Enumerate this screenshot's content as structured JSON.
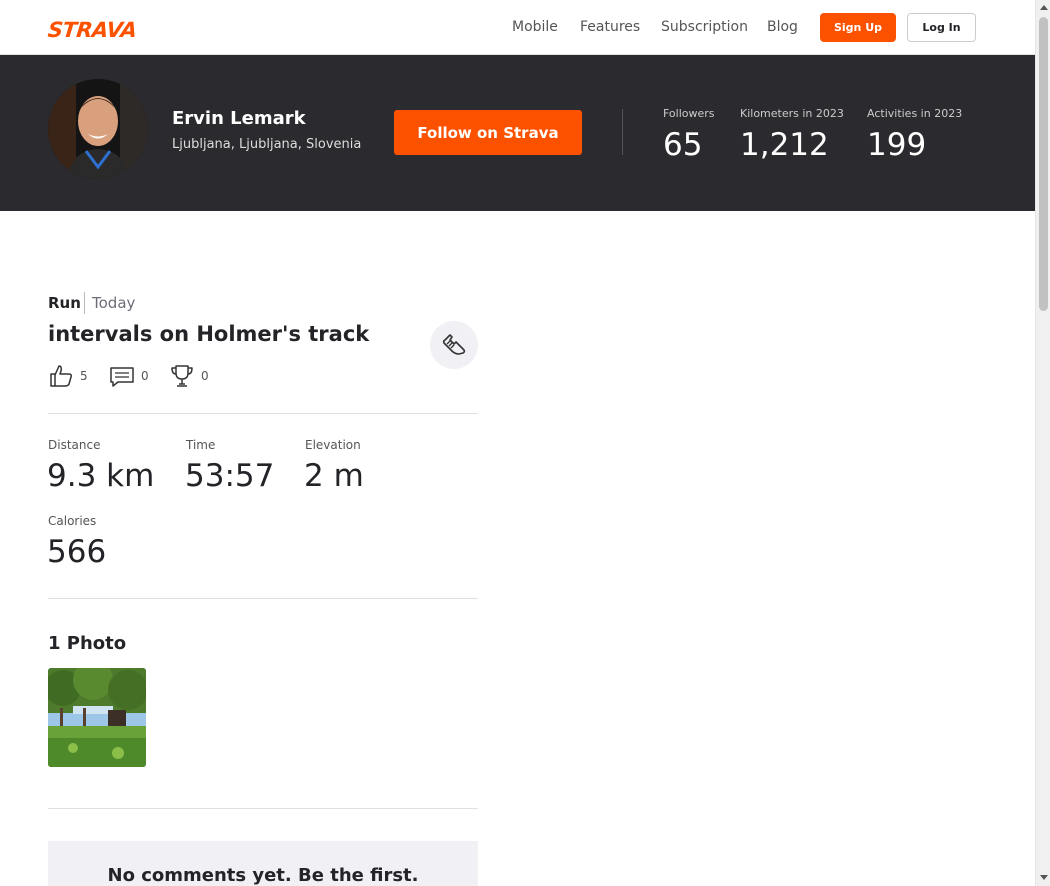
{
  "nav": {
    "logo": "STRAVA",
    "links": [
      "Mobile",
      "Features",
      "Subscription",
      "Blog"
    ],
    "signup_label": "Sign Up",
    "login_label": "Log In"
  },
  "athlete": {
    "name": "Ervin Lemark",
    "location": "Ljubljana, Ljubljana, Slovenia",
    "follow_label": "Follow on Strava",
    "stats": [
      {
        "label": "Followers",
        "value": "65"
      },
      {
        "label": "Kilometers in 2023",
        "value": "1,212"
      },
      {
        "label": "Activities in 2023",
        "value": "199"
      }
    ]
  },
  "activity": {
    "type": "Run",
    "date": "Today",
    "title": "intervals on Holmer's track",
    "icon": "shoe-icon",
    "kudos": "5",
    "comments": "0",
    "achievements": "0",
    "metrics": [
      {
        "label": "Distance",
        "value": "9.3 km"
      },
      {
        "label": "Time",
        "value": "53:57"
      },
      {
        "label": "Elevation",
        "value": "2 m"
      },
      {
        "label": "Calories",
        "value": "566"
      }
    ]
  },
  "photos": {
    "title": "1 Photo"
  },
  "comments": {
    "empty_text": "No comments yet. Be the first."
  },
  "colors": {
    "accent": "#fc5200",
    "header_bg": "#2b2a2e"
  }
}
